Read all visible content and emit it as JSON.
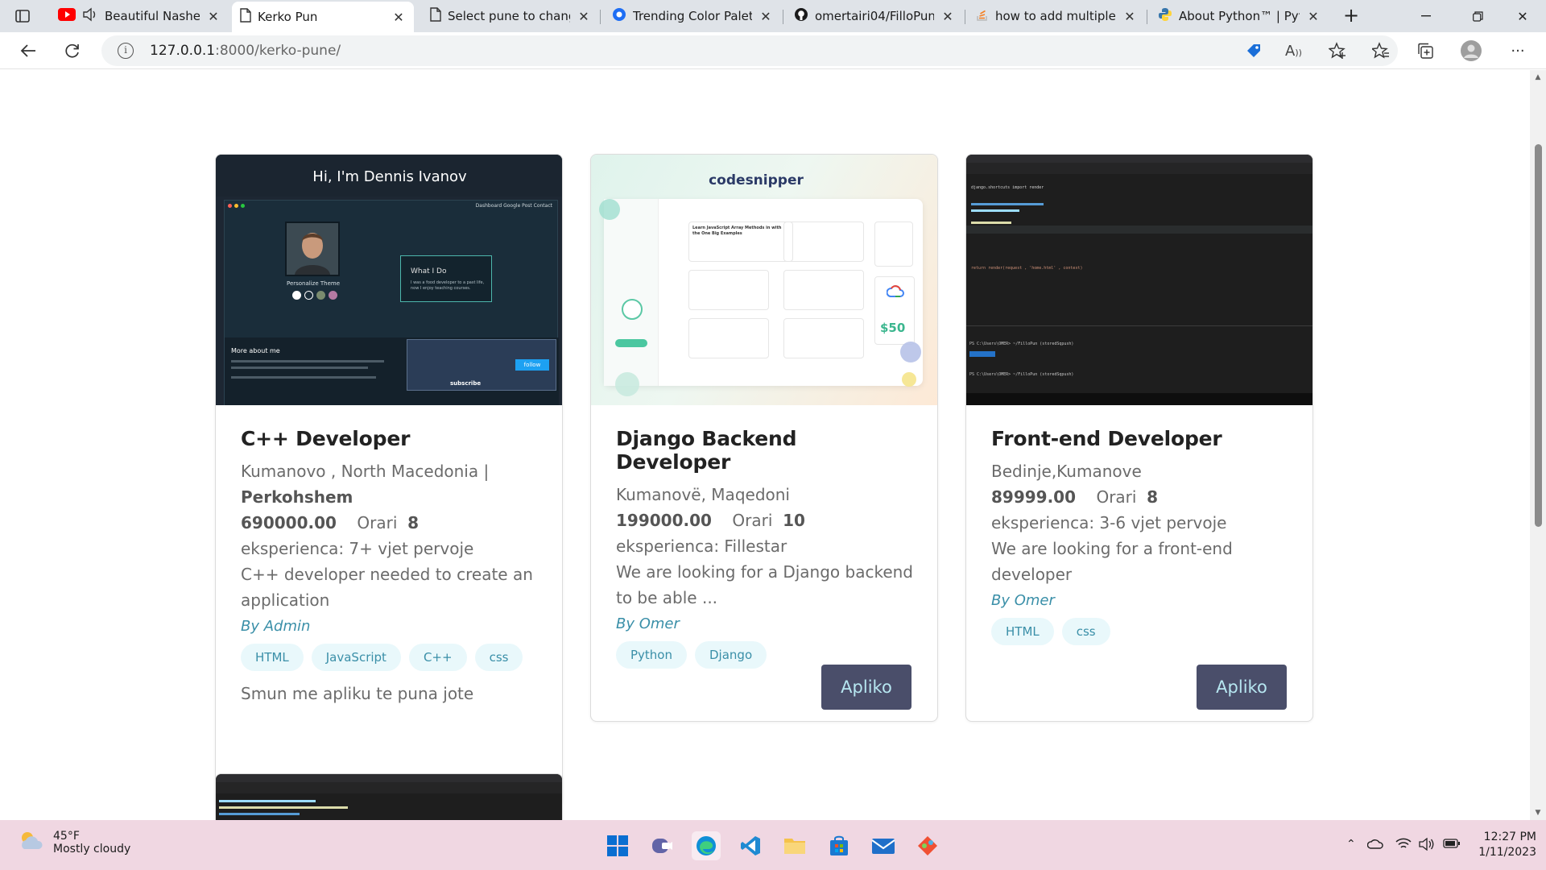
{
  "browser": {
    "tabs": [
      {
        "title": "Beautiful Nasheed",
        "icon": "youtube-icon",
        "audio": true,
        "active": false
      },
      {
        "title": "Kerko Pun",
        "icon": "document-icon",
        "active": true
      },
      {
        "title": "Select pune to change",
        "icon": "document-icon",
        "active": false
      },
      {
        "title": "Trending Color Palettes",
        "icon": "coolors-icon",
        "active": false
      },
      {
        "title": "omertairi04/FilloPun",
        "icon": "github-icon",
        "active": false
      },
      {
        "title": "how to add multiple i",
        "icon": "stackoverflow-icon",
        "active": false
      },
      {
        "title": "About Python™ | Pyth",
        "icon": "python-icon",
        "active": false
      }
    ],
    "url_host": "127.0.0.1",
    "url_path": ":8000/kerko-pune/"
  },
  "cards": [
    {
      "title": "C++ Developer",
      "location": "Kumanovo , North Macedonia |",
      "type": "Perkohshem",
      "salary": "690000.00",
      "hours_label": "Orari",
      "hours": "8",
      "experience": "eksperienca: 7+ vjet pervoje",
      "description": "C++ developer needed to create an application",
      "author": "By Admin",
      "tags": [
        "HTML",
        "JavaScript",
        "C++",
        "css"
      ],
      "note": "Smun me apliku te puna jote",
      "thumb": {
        "heading": "Hi, I'm Dennis Ivanov",
        "nav": "Dashboard  Google Post  Contact",
        "name": "Personalize Theme",
        "box_title": "What I Do",
        "box_text": "I was a food developer to a past life, now I enjoy teaching courses.",
        "more": "More about me",
        "subscribe": "subscribe",
        "follow": "follow"
      }
    },
    {
      "title": "Django Backend Developer",
      "location": "Kumanovë, Maqedoni",
      "salary": "199000.00",
      "hours_label": "Orari",
      "hours": "10",
      "experience": "eksperienca: Fillestar",
      "description": "We are looking for a Django backend to be able ...",
      "author": "By Omer",
      "tags": [
        "Python",
        "Django"
      ],
      "apply": "Apliko",
      "thumb": {
        "brand": "codesnipper",
        "price": "$50",
        "card_title": "Learn JavaScript Array Methods in with the One Big Examples"
      }
    },
    {
      "title": "Front-end Developer",
      "location": "Bedinje,Kumanove",
      "salary": "89999.00",
      "hours_label": "Orari",
      "hours": "8",
      "experience": "eksperienca: 3-6 vjet pervoje",
      "description": "We are looking for a front-end developer",
      "author": "By Omer",
      "tags": [
        "HTML",
        "css"
      ],
      "apply": "Apliko",
      "thumb": {
        "line1": "django.shortcuts import render",
        "line2": "return render(request , 'home.html' , context)",
        "term1": "PS C:\\Users\\OMER> ~/FilloPun (storedSqpush)",
        "term2": "PS C:\\Users\\OMER> ~/FilloPun (storedSqpush)"
      }
    }
  ],
  "taskbar": {
    "temp": "45°F",
    "condition": "Mostly cloudy",
    "time": "12:27 PM",
    "date": "1/11/2023"
  }
}
